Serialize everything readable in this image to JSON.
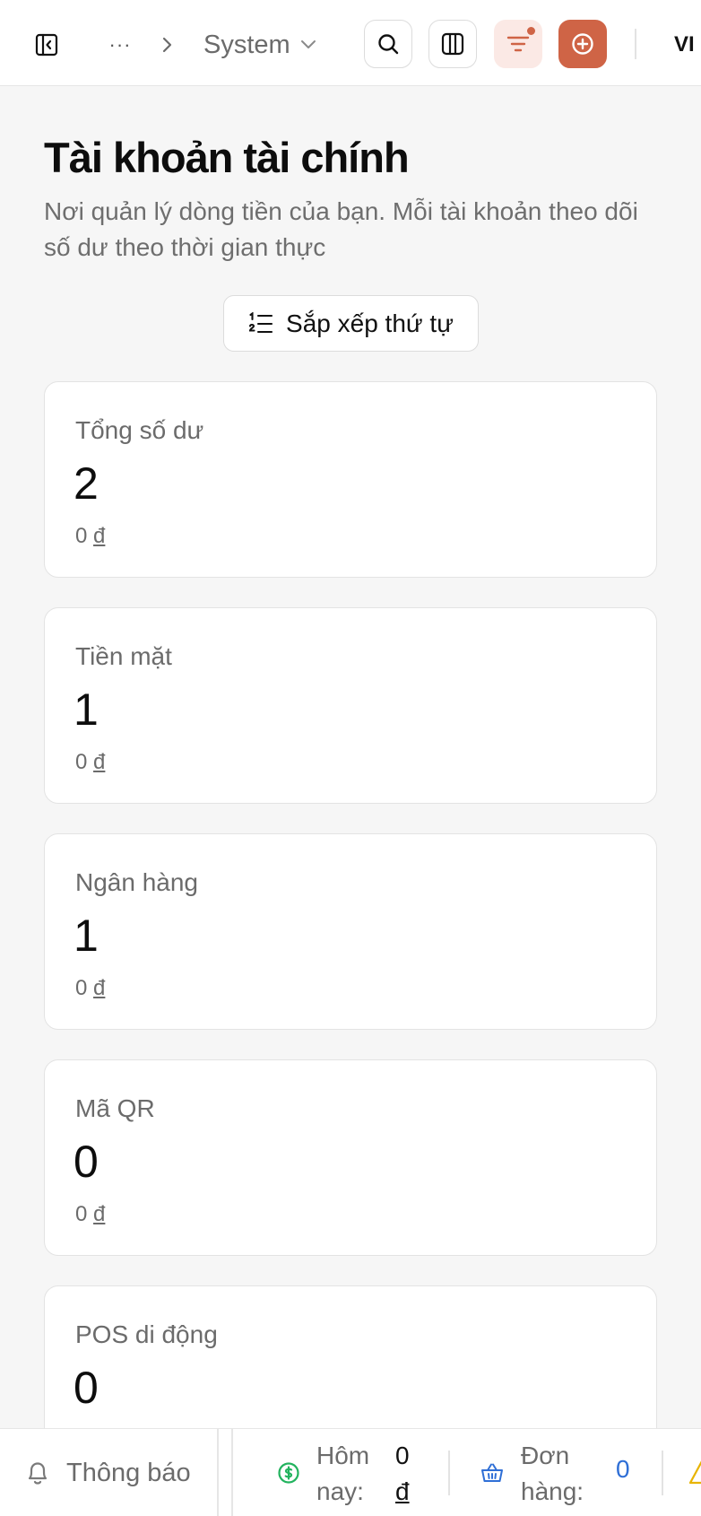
{
  "topbar": {
    "breadcrumb_more": "···",
    "breadcrumb_current": "System",
    "language": "VI"
  },
  "page": {
    "title": "Tài khoản tài chính",
    "description": "Nơi quản lý dòng tiền của bạn. Mỗi tài khoản theo dõi số dư theo thời gian thực",
    "sort_button": "Sắp xếp thứ tự"
  },
  "cards": [
    {
      "label": "Tổng số dư",
      "count": "2",
      "amount": "0",
      "currency": "đ"
    },
    {
      "label": "Tiền mặt",
      "count": "1",
      "amount": "0",
      "currency": "đ"
    },
    {
      "label": "Ngân hàng",
      "count": "1",
      "amount": "0",
      "currency": "đ"
    },
    {
      "label": "Mã QR",
      "count": "0",
      "amount": "0",
      "currency": "đ"
    },
    {
      "label": "POS di động",
      "count": "0"
    }
  ],
  "statusbar": {
    "notifications": "Thông báo",
    "today_label": "Hôm nay:",
    "today_value": "0",
    "today_currency": "đ",
    "orders_label": "Đơn hàng:",
    "orders_value": "0"
  },
  "colors": {
    "accent": "#cf6446",
    "accent_soft": "#fbe9e5",
    "money_green": "#22b35e",
    "orders_blue": "#2f6fd6",
    "warning_yellow": "#e8b400"
  }
}
